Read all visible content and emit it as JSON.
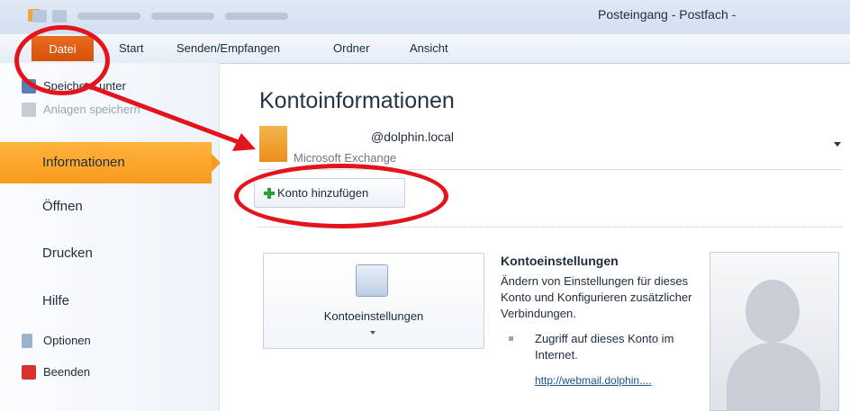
{
  "window": {
    "title": "Posteingang - Postfach -"
  },
  "ribbon": {
    "tabs": [
      "Datei",
      "Start",
      "Senden/Empfangen",
      "Ordner",
      "Ansicht"
    ]
  },
  "sidebar": {
    "save_as": "Speichern unter",
    "save_attachments": "Anlagen speichern",
    "items": [
      "Informationen",
      "Öffnen",
      "Drucken",
      "Hilfe"
    ],
    "options": "Optionen",
    "exit": "Beenden"
  },
  "main": {
    "heading": "Kontoinformationen",
    "account": {
      "email": "@dolphin.local",
      "type": "Microsoft Exchange"
    },
    "add_account": "Konto hinzufügen",
    "account_settings": {
      "button_label": "Kontoeinstellungen",
      "title": "Kontoeinstellungen",
      "description": "Ändern von Einstellungen für dieses Konto und Konfigurieren zusätzlicher Verbindungen.",
      "bullet": "Zugriff auf dieses Konto im Internet.",
      "link": "http://webmail.dolphin...."
    }
  },
  "annotations": {
    "color": "#e3141b"
  }
}
